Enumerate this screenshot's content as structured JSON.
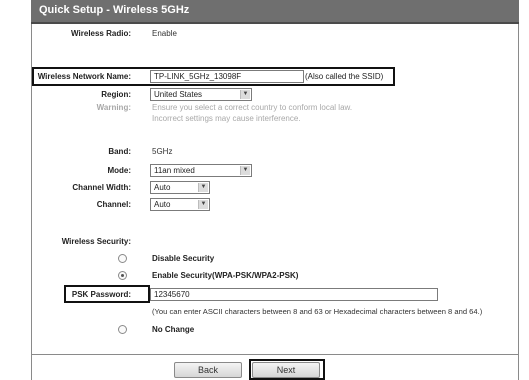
{
  "title": "Quick Setup - Wireless 5GHz",
  "radio": {
    "label": "Wireless Radio:",
    "value": "Enable"
  },
  "ssid": {
    "label": "Wireless Network Name:",
    "value": "TP-LINK_5GHz_13098F",
    "note": "(Also called the SSID)"
  },
  "region": {
    "label": "Region:",
    "value": "United States",
    "warning_label": "Warning:",
    "warning_line1": "Ensure you select a correct country to conform local law.",
    "warning_line2": "Incorrect settings may cause interference."
  },
  "band": {
    "label": "Band:",
    "value": "5GHz"
  },
  "mode": {
    "label": "Mode:",
    "value": "11an mixed"
  },
  "channel_width": {
    "label": "Channel Width:",
    "value": "Auto"
  },
  "channel": {
    "label": "Channel:",
    "value": "Auto"
  },
  "security": {
    "label": "Wireless Security:",
    "disable": "Disable Security",
    "enable": "Enable Security(WPA-PSK/WPA2-PSK)",
    "psk_label": "PSK Password:",
    "psk_value": "12345670",
    "psk_hint": "(You can enter ASCII characters between 8 and 63 or Hexadecimal characters between 8 and 64.)",
    "no_change": "No Change",
    "selected": "enable"
  },
  "buttons": {
    "back": "Back",
    "next": "Next"
  }
}
